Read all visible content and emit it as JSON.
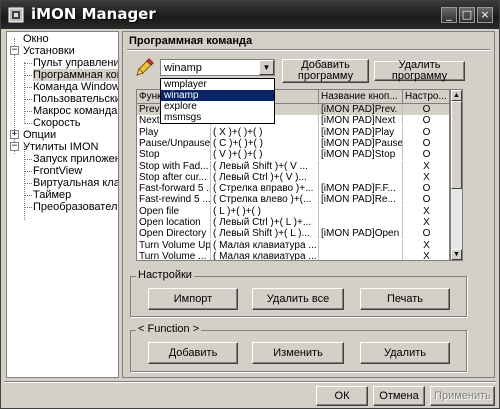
{
  "window": {
    "title": "iMON Manager",
    "title_buttons": [
      "_",
      "□",
      "×"
    ]
  },
  "nav": {
    "items": [
      {
        "label": "Окно",
        "level": 0,
        "expander": ""
      },
      {
        "label": "Установки",
        "level": 0,
        "expander": "−"
      },
      {
        "label": "Пульт управления",
        "level": 1,
        "expander": ""
      },
      {
        "label": "Программная команда",
        "level": 1,
        "expander": "",
        "selected": true
      },
      {
        "label": "Команда Windows",
        "level": 1,
        "expander": ""
      },
      {
        "label": "Пользовательские",
        "level": 1,
        "expander": ""
      },
      {
        "label": "Макрос команда",
        "level": 1,
        "expander": ""
      },
      {
        "label": "Скорость",
        "level": 1,
        "expander": ""
      },
      {
        "label": "Опции",
        "level": 0,
        "expander": "+"
      },
      {
        "label": "Утилиты IMON",
        "level": 0,
        "expander": "−"
      },
      {
        "label": "Запуск приложен",
        "level": 1,
        "expander": ""
      },
      {
        "label": "FrontView",
        "level": 1,
        "expander": ""
      },
      {
        "label": "Виртуальная клав",
        "level": 1,
        "expander": ""
      },
      {
        "label": "Таймер",
        "level": 1,
        "expander": ""
      },
      {
        "label": "Преобразователь",
        "level": 1,
        "expander": ""
      }
    ]
  },
  "panel": {
    "title": "Программная команда",
    "program_combo": {
      "value": "winamp",
      "options": [
        "wmplayer",
        "winamp",
        "explore",
        "msmsgs"
      ],
      "highlighted": "winamp"
    },
    "add_program_label": "Добавить программу",
    "remove_program_label": "Удалить программу",
    "table": {
      "columns": [
        "Функция",
        "Кнопка",
        "Название кноп...",
        "Настро..."
      ],
      "rows": [
        {
          "func": "Previous",
          "key": "",
          "name": "[iMON PAD]Prev.",
          "setting": "O",
          "selected": true
        },
        {
          "func": "Next",
          "key": "",
          "name": "[iMON PAD]Next",
          "setting": "O"
        },
        {
          "func": "Play",
          "key": "( X )+(  )+(  )",
          "name": "[iMON PAD]Play",
          "setting": "O"
        },
        {
          "func": "Pause/Unpause",
          "key": "( C )+(  )+(  )",
          "name": "[iMON PAD]Pause",
          "setting": "O"
        },
        {
          "func": "Stop",
          "key": "( V )+(  )+(  )",
          "name": "[iMON PAD]Stop",
          "setting": "O"
        },
        {
          "func": "Stop with Fad...",
          "key": "( Левый Shift )+( V ...",
          "name": "",
          "setting": "X"
        },
        {
          "func": "Stop after cur...",
          "key": "( Левый Ctrl )+( V )...",
          "name": "",
          "setting": "X"
        },
        {
          "func": "Fast-forward 5 ...",
          "key": "( Стрелка вправо )+...",
          "name": "[iMON PAD]F.F...",
          "setting": "O"
        },
        {
          "func": "Fast-rewind 5 ...",
          "key": "( Стрелка влево )+(...",
          "name": "[iMON PAD]Re...",
          "setting": "O"
        },
        {
          "func": "Open file",
          "key": "( L )+(  )+(  )",
          "name": "",
          "setting": "X"
        },
        {
          "func": "Open location",
          "key": "( Левый Ctrl )+( L )+...",
          "name": "",
          "setting": "X"
        },
        {
          "func": "Open Directory",
          "key": "( Левый Shift )+( L )...",
          "name": "[iMON PAD]Open",
          "setting": "O"
        },
        {
          "func": "Turn Volume Up",
          "key": "( Малая клавиатура ...",
          "name": "",
          "setting": "X"
        },
        {
          "func": "Turn Volume ...",
          "key": "( Малая клавиатура ...",
          "name": "",
          "setting": "X"
        }
      ]
    },
    "settings_group": {
      "label": "Настройки",
      "import_label": "Импорт",
      "delete_all_label": "Удалить все",
      "print_label": "Печать"
    },
    "function_group": {
      "label": "< Function >",
      "add_label": "Добавить",
      "change_label": "Изменить",
      "delete_label": "Удалить"
    }
  },
  "footer": {
    "ok_label": "ОК",
    "cancel_label": "Отмена",
    "apply_label": "Применить"
  }
}
